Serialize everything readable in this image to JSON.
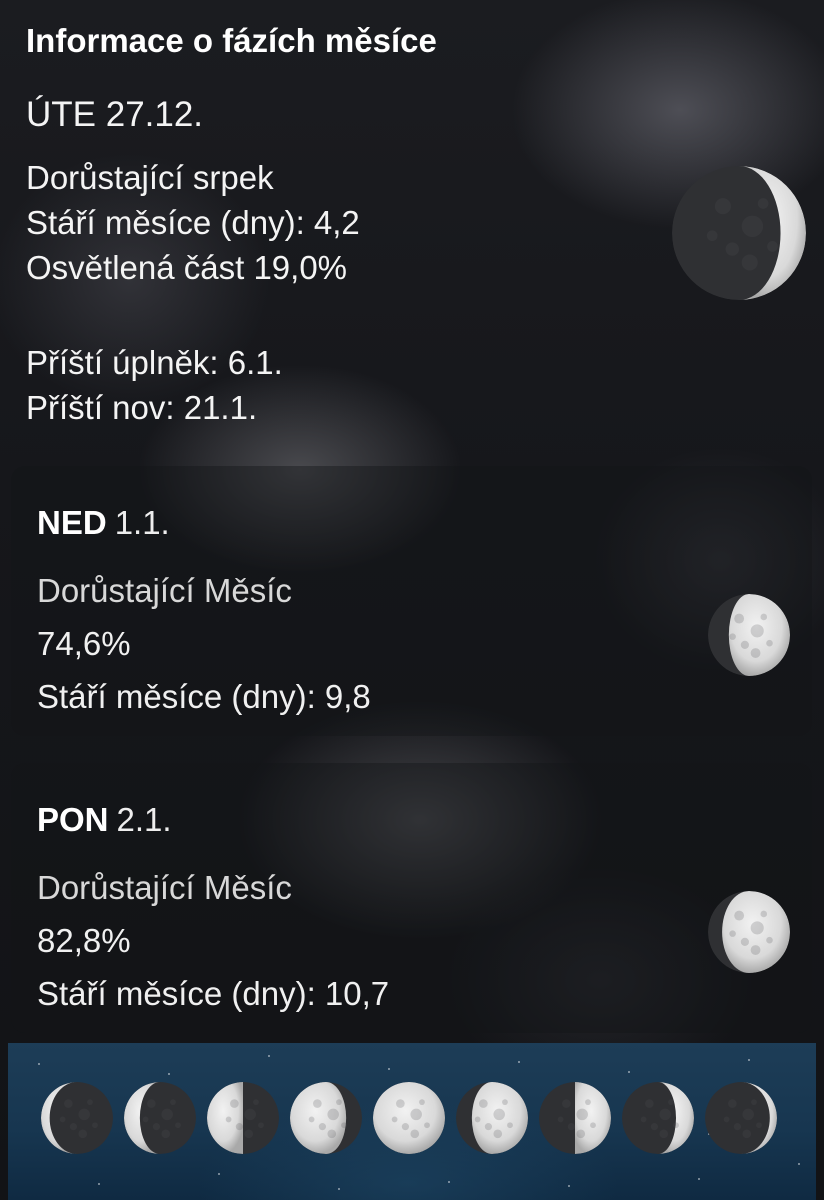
{
  "title": "Informace o fázích měsíce",
  "current": {
    "date": "ÚTE 27.12.",
    "phase_name": "Dorůstající srpek",
    "age_label": "Stáří měsíce (dny): 4,2",
    "illumination_label": "Osvětlená část  19,0%",
    "illumination": 0.19
  },
  "next": {
    "full_moon": "Příští úplněk:  6.1.",
    "new_moon": "Příští nov:  21.1."
  },
  "days": [
    {
      "day": "NED",
      "date": "1.1.",
      "phase": "Dorůstající Měsíc",
      "illumination_label": "74,6%",
      "illumination": 0.746,
      "age": "Stáří měsíce (dny): 9,8"
    },
    {
      "day": "PON",
      "date": "2.1.",
      "phase": "Dorůstající Měsíc",
      "illumination_label": "82,8%",
      "illumination": 0.828,
      "age": "Stáří měsíce (dny): 10,7"
    }
  ],
  "phase_strip": [
    {
      "fraction": 0.12,
      "waxing": false
    },
    {
      "fraction": 0.22,
      "waxing": false
    },
    {
      "fraction": 0.5,
      "waxing": false
    },
    {
      "fraction": 0.78,
      "waxing": false
    },
    {
      "fraction": 1.0,
      "waxing": true
    },
    {
      "fraction": 0.78,
      "waxing": true
    },
    {
      "fraction": 0.5,
      "waxing": true
    },
    {
      "fraction": 0.25,
      "waxing": true
    },
    {
      "fraction": 0.1,
      "waxing": true
    }
  ],
  "colors": {
    "moon_lit": "#d9d9d9",
    "moon_shadow": "#2f3033",
    "strip_bg": "#173650"
  }
}
